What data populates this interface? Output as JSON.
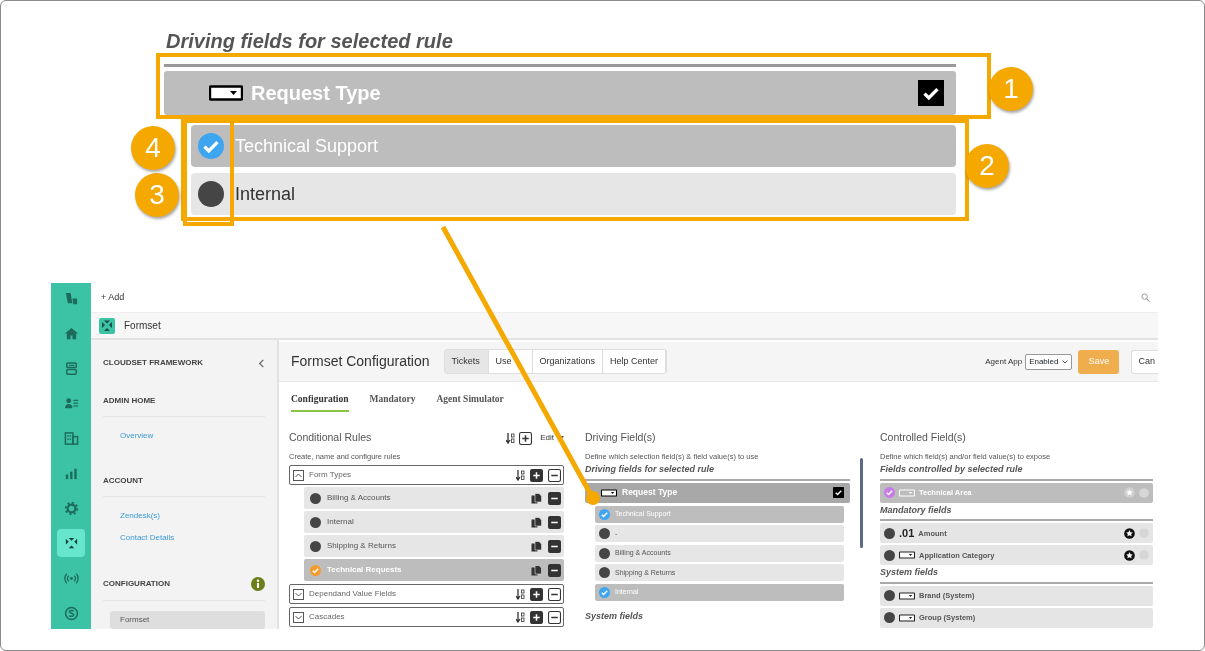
{
  "callout": {
    "title": "Driving fields for selected rule",
    "field": {
      "label": "Request Type",
      "checked": true
    },
    "options": [
      {
        "label": "Technical Support",
        "selected": true
      },
      {
        "label": "Internal",
        "selected": false
      }
    ],
    "markers": [
      "1",
      "2",
      "3",
      "4"
    ]
  },
  "app": {
    "rail": [
      {
        "kind": "logo",
        "selected": false
      },
      {
        "kind": "home",
        "selected": false
      },
      {
        "kind": "inbox",
        "selected": false
      },
      {
        "kind": "contacts",
        "selected": false
      },
      {
        "kind": "buildings",
        "selected": false
      },
      {
        "kind": "chart",
        "selected": false
      },
      {
        "kind": "gear",
        "selected": false
      },
      {
        "kind": "arrows",
        "selected": true
      },
      {
        "kind": "signal",
        "selected": false
      },
      {
        "kind": "coin",
        "selected": false
      }
    ],
    "add": "+ Add",
    "brand": "Formset",
    "sidebar": {
      "title": "CLOUDSET FRAMEWORK",
      "sections": [
        {
          "title": "ADMIN HOME",
          "info": false,
          "items": [
            {
              "label": "Overview",
              "selected": false
            }
          ]
        },
        {
          "title": "ACCOUNT",
          "info": false,
          "items": [
            {
              "label": "Zendesk(s)",
              "selected": false
            },
            {
              "label": "Contact Details",
              "selected": false
            }
          ]
        },
        {
          "title": "CONFIGURATION",
          "info": true,
          "items": [
            {
              "label": "Formset",
              "selected": true
            }
          ]
        }
      ]
    },
    "header": {
      "title": "Formset Configuration",
      "tabs": [
        {
          "label": "Tickets",
          "selected": true
        },
        {
          "label": "Use",
          "selected": false
        },
        {
          "label": "Organizations",
          "selected": false
        },
        {
          "label": "Help Center",
          "selected": false
        }
      ],
      "agent_app_label": "Agent App",
      "agent_app_value": "Enabled",
      "save": "Save",
      "cancel": "Can"
    },
    "subtabs": [
      {
        "label": "Configuration",
        "selected": true
      },
      {
        "label": "Mandatory",
        "selected": false
      },
      {
        "label": "Agent Simulator",
        "selected": false
      }
    ],
    "rules": {
      "title": "Conditional Rules",
      "subtitle": "Create, name and configure rules",
      "edit": "Edit",
      "groups": [
        {
          "label": "Form Types",
          "expanded": true,
          "children": [
            {
              "label": "Billing & Accounts",
              "selected": false
            },
            {
              "label": "Internal",
              "selected": false
            },
            {
              "label": "Shipping & Returns",
              "selected": false
            },
            {
              "label": "Technical Requests",
              "selected": true
            }
          ]
        },
        {
          "label": "Dependand Value Fields",
          "expanded": false
        },
        {
          "label": "Cascades",
          "expanded": false
        }
      ]
    },
    "driving": {
      "title": "Driving Field(s)",
      "subtitle": "Define which selection field(s) & field value(s) to use",
      "section": "Driving fields for selected rule",
      "field": {
        "label": "Request Type",
        "checked": true
      },
      "options": [
        {
          "label": "Technical Support",
          "selected": true
        },
        {
          "label": "-",
          "selected": false
        },
        {
          "label": "Billing & Accounts",
          "selected": false
        },
        {
          "label": "Shipping & Returns",
          "selected": false
        },
        {
          "label": "Internal",
          "selected": true
        }
      ],
      "next_section": "System fields"
    },
    "controlled": {
      "title": "Controlled Field(s)",
      "subtitle": "Define which field(s) and/or field value(s) to expose",
      "sections": [
        {
          "title": "Fields controlled by selected rule",
          "fields": [
            {
              "kind": "dropdown",
              "label": "Technical Area",
              "selected": true,
              "mandatory": false
            }
          ]
        },
        {
          "title": "Mandatory fields",
          "fields": [
            {
              "kind": "number",
              "prefix": ".01",
              "label": "Amount",
              "selected": false,
              "mandatory": true
            },
            {
              "kind": "dropdown",
              "label": "Application Category",
              "selected": false,
              "mandatory": true
            }
          ]
        },
        {
          "title": "System fields",
          "fields": [
            {
              "kind": "dropdown",
              "label": "Brand (System)",
              "selected": false
            },
            {
              "kind": "dropdown",
              "label": "Group (System)",
              "selected": false
            }
          ]
        }
      ]
    }
  }
}
